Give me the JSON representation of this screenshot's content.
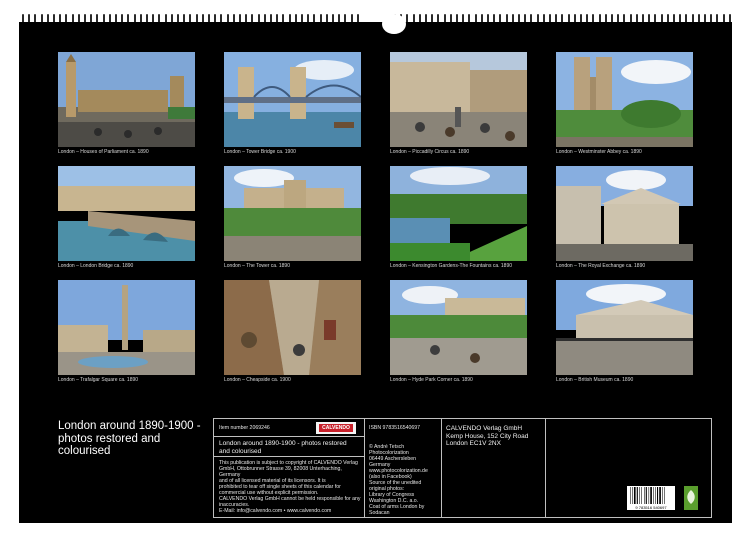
{
  "photos": [
    {
      "caption": "London – Houses of Parliament ca. 1890",
      "icon": "houses-of-parliament-photo"
    },
    {
      "caption": "London – Tower Bridge ca. 1900",
      "icon": "tower-bridge-photo"
    },
    {
      "caption": "London – Piccadilly Circus ca. 1890",
      "icon": "piccadilly-circus-photo"
    },
    {
      "caption": "London – Westminster Abbey ca. 1890",
      "icon": "westminster-abbey-photo"
    },
    {
      "caption": "London – London Bridge ca. 1890",
      "icon": "london-bridge-photo"
    },
    {
      "caption": "London – The Tower ca. 1890",
      "icon": "the-tower-photo"
    },
    {
      "caption": "London – Kensington Gardens-The Fountains ca. 1890",
      "icon": "kensington-gardens-photo"
    },
    {
      "caption": "London – The Royal Exchange ca. 1890",
      "icon": "royal-exchange-photo"
    },
    {
      "caption": "London – Trafalgar Square ca. 1890",
      "icon": "trafalgar-square-photo"
    },
    {
      "caption": "London – Cheapside ca. 1900",
      "icon": "cheapside-photo"
    },
    {
      "caption": "London – Hyde Park Corner ca. 1890",
      "icon": "hyde-park-corner-photo"
    },
    {
      "caption": "London – British Museum ca. 1890",
      "icon": "british-museum-photo"
    }
  ],
  "cover_title": "London around 1890-1900 - photos restored and colourised",
  "info": {
    "item_number": "Item number 2069246",
    "publisher_logo": "CALVENDO",
    "product_title": "London around 1890-1900 - photos restored and colourised",
    "copyright_lines": [
      "This publication is subject to copyright of CALVENDO Verlag",
      "GmbH, Ottobrunner Strasse 39, 82008 Unterhaching, Germany",
      "and of all licensed material of its licensors. It is",
      "prohibited to tear off single sheets of this calendar for",
      "commercial use without explicit permission.",
      "CALVENDO Verlag GmbH cannot be held responsible for any",
      "inaccuracies.",
      "E-Mail: info@calvendo.com • www.calvendo.com"
    ],
    "isbn": "ISBN 9783516540697",
    "publisher_address_lines": [
      "CALVENDO Verlag GmbH",
      "Kemp House, 152 City Road",
      "London EC1V 2NX"
    ],
    "credits_lines": [
      "© André Tetsch Photocolorization",
      "06449 Aschersleben",
      "Germany",
      "www.photocolorization.de",
      "(also in Facebook)",
      "Source of the unedited original photos:",
      "Library of Congress Washington D.C. a.o.",
      "Coat of arms London by Sodacan"
    ],
    "barcode_text": "9 783516 540697"
  },
  "colors": {
    "background": "#000000",
    "paper": "#ffffff",
    "rule": "#bfbfbf",
    "seal_green": "#5a9e2d"
  }
}
